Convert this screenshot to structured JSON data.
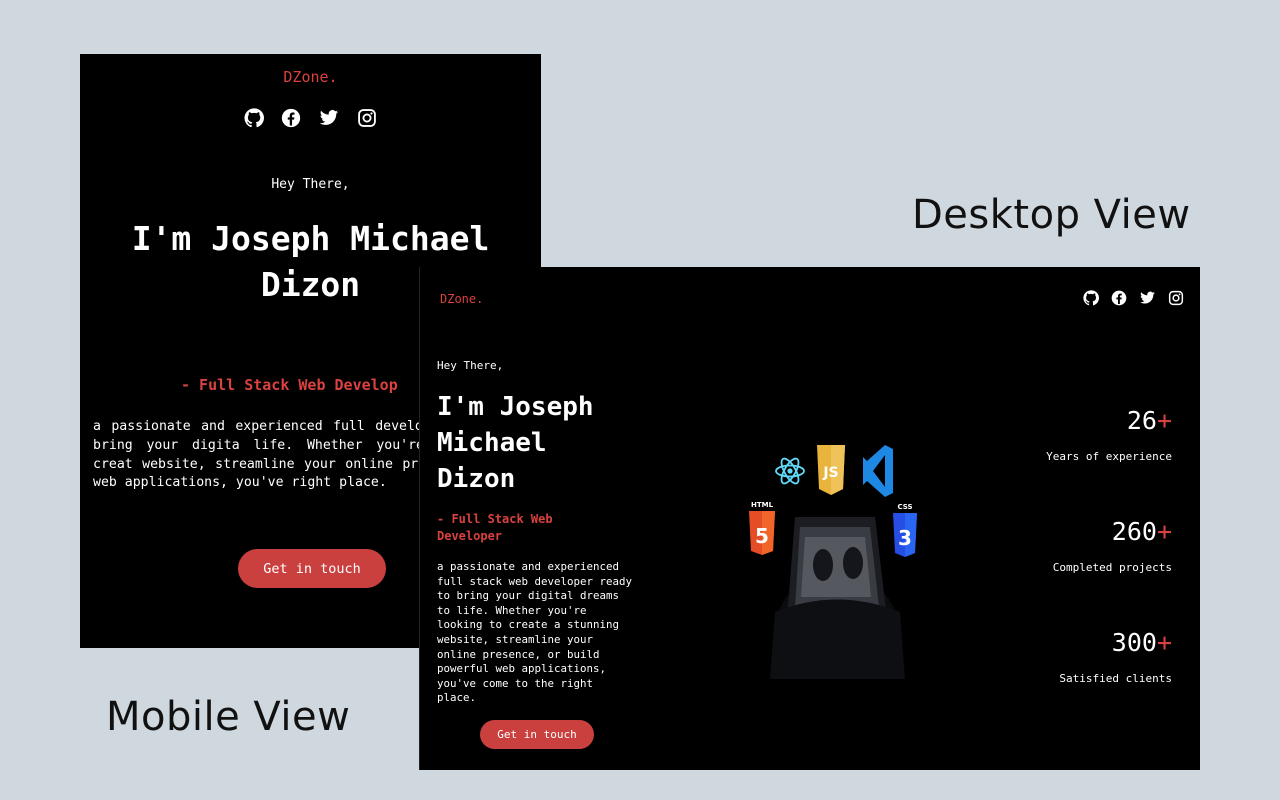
{
  "captions": {
    "desktop": "Desktop View",
    "mobile": "Mobile View"
  },
  "brand": "DZone.",
  "socials": [
    "github-icon",
    "facebook-icon",
    "twitter-icon",
    "instagram-icon"
  ],
  "hero": {
    "greeting": "Hey There,",
    "name": "I'm Joseph Michael Dizon",
    "role": "- Full Stack Web Developer",
    "bio": "a passionate and experienced full stack web developer ready to bring your digital dreams to life. Whether you're looking to create a stunning website, streamline your online presence, or build powerful web applications, you've come to the right place.",
    "cta": "Get in touch"
  },
  "mobile": {
    "role_visible": "- Full Stack Web Develop",
    "bio_visible": "a passionate and experienced full developer ready to bring your digita life. Whether you're looking to creat website, streamline your online presen powerful web applications, you've right place."
  },
  "tech_icons": [
    "react-icon",
    "javascript-icon",
    "vscode-icon",
    "html5-icon",
    "css3-icon"
  ],
  "tech_labels": {
    "html": "HTML",
    "js": "JS",
    "css": "CSS"
  },
  "stats": [
    {
      "value": "26",
      "suffix": "+",
      "label": "Years of experience"
    },
    {
      "value": "260",
      "suffix": "+",
      "label": "Completed projects"
    },
    {
      "value": "300",
      "suffix": "+",
      "label": "Satisfied clients"
    }
  ],
  "colors": {
    "accent": "#d9423f",
    "button": "#c9403f",
    "background": "#cfd8de",
    "panel": "#000000"
  }
}
